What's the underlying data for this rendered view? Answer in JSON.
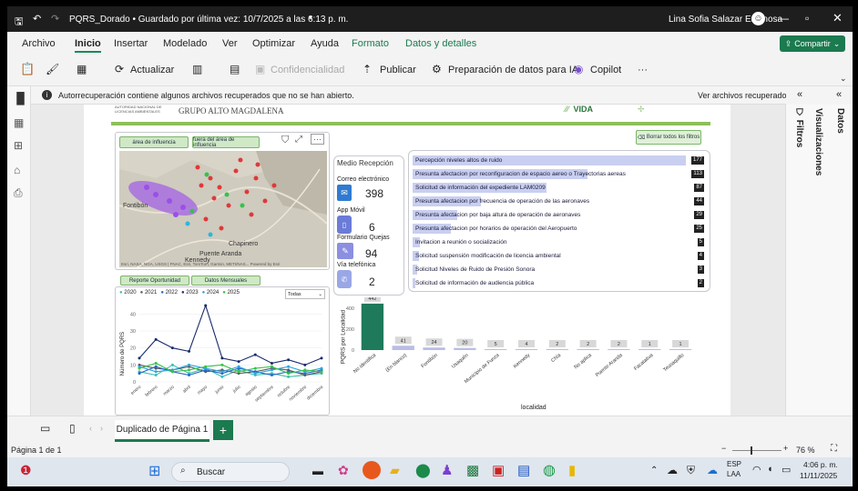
{
  "title_bar": {
    "file_title": "PQRS_Dorado • Guardado por última vez: 10/7/2025 a las 6:13 p. m.",
    "user": "Lina Sofia Salazar Espinosa"
  },
  "ribbon": {
    "tabs": [
      "Archivo",
      "Inicio",
      "Insertar",
      "Modelado",
      "Ver",
      "Optimizar",
      "Ayuda",
      "Formato",
      "Datos y detalles"
    ],
    "share": "Compartir",
    "toolbar": {
      "refresh": "Actualizar",
      "confidentiality": "Confidencialidad",
      "publish": "Publicar",
      "ai_prep": "Preparación de datos para IA",
      "copilot": "Copilot",
      "more": "···"
    }
  },
  "infobar": {
    "message": "Autorrecuperación contiene algunos archivos recuperados que no se han abierto.",
    "action": "Ver archivos recuperados"
  },
  "report": {
    "org_small": "AUTORIDAD NACIONAL DE LICENCIAS AMBIENTALES",
    "header": "GRUPO ALTO MAGDALENA",
    "logo": "VIDA",
    "clear_filters": "Borrar todos los filtros",
    "map_buttons": [
      "área de influencia",
      "fuera del área de influencia"
    ],
    "map_places": [
      "Fontibón",
      "Chapinero",
      "Puente Aranda",
      "Kennedy"
    ],
    "map_attribution": "Esri, NASA, NGA, USGS | FNAC, Esri, TomTom, Garmin, METI/NAS...   Powered by Esri",
    "tabs": [
      "Reporte Oportunidad",
      "Datos Mensuales"
    ],
    "medio": {
      "title": "Medio Recepción",
      "items": [
        {
          "label": "Correo electrónico",
          "value": "398"
        },
        {
          "label": "App Móvil",
          "value": "6"
        },
        {
          "label": "Formulario Quejas",
          "value": "94"
        },
        {
          "label": "Vía telefónica",
          "value": "2"
        }
      ]
    },
    "top_list": [
      {
        "label": "Percepción niveles altos de ruido",
        "value": "177"
      },
      {
        "label": "Presunta afectacion por reconfiguracion de espacio aereo o Trayectorias aereas",
        "value": "113"
      },
      {
        "label": "Solicitud de información del expediente LAM0209",
        "value": "87"
      },
      {
        "label": "Presunta afectacion por frecuencia de operación de las aeronaves",
        "value": "44"
      },
      {
        "label": "Presunta afectacion por baja altura de operación de aeronaves",
        "value": "29"
      },
      {
        "label": "Presunta afectacion por horarios de operación del Aeropuerto",
        "value": "25"
      },
      {
        "label": "Invitacion a reunión o socialización",
        "value": "5"
      },
      {
        "label": "Solicitud suspensión modificación de licencia ambiental",
        "value": "4"
      },
      {
        "label": "Solicitud Niveles de Ruido de Presión Sonora",
        "value": "3"
      },
      {
        "label": "Solicitud de información de audiencia pública",
        "value": "2"
      }
    ],
    "line_chart": {
      "legend": [
        "2020",
        "2021",
        "2022",
        "2023",
        "2024",
        "2025"
      ],
      "filter": "Todas",
      "ylabel": "Número de PQRS",
      "months": [
        "enero",
        "febrero",
        "marzo",
        "abril",
        "mayo",
        "junio",
        "julio",
        "agosto",
        "septiembre",
        "octubre",
        "noviembre",
        "diciembre"
      ]
    },
    "bar_chart": {
      "ylabel": "PQRS por Localidad",
      "xlabel": "localidad"
    }
  },
  "side_panes": [
    "Filtros",
    "Visualizaciones",
    "Datos"
  ],
  "page_tab": "Duplicado de Página 1",
  "status": {
    "page": "Página 1 de 1",
    "zoom": "76 %"
  },
  "taskbar": {
    "search": "Buscar",
    "lang": "ESP",
    "lang2": "LAA",
    "time": "4:06 p. m.",
    "date": "11/11/2025"
  },
  "chart_data": [
    {
      "type": "line",
      "title": "",
      "ylabel": "Número de PQRS",
      "categories": [
        "enero",
        "febrero",
        "marzo",
        "abril",
        "mayo",
        "junio",
        "julio",
        "agosto",
        "septiembre",
        "octubre",
        "noviembre",
        "diciembre"
      ],
      "ylim": [
        0,
        45
      ],
      "series": [
        {
          "name": "2020",
          "color": "#3cbfb0",
          "values": [
            6,
            4,
            10,
            5,
            8,
            3,
            7,
            4,
            5,
            3,
            4,
            5
          ]
        },
        {
          "name": "2021",
          "color": "#5b5b5b",
          "values": [
            10,
            8,
            7,
            9,
            6,
            7,
            5,
            6,
            8,
            7,
            4,
            6
          ]
        },
        {
          "name": "2022",
          "color": "#2a66c8",
          "values": [
            5,
            9,
            6,
            4,
            7,
            5,
            8,
            6,
            4,
            6,
            5,
            7
          ]
        },
        {
          "name": "2023",
          "color": "#1a2a6c",
          "values": [
            14,
            25,
            20,
            18,
            45,
            14,
            12,
            16,
            11,
            13,
            10,
            14
          ]
        },
        {
          "name": "2024",
          "color": "#2fa3e0",
          "values": [
            9,
            6,
            7,
            10,
            8,
            6,
            9,
            5,
            7,
            9,
            6,
            8
          ]
        },
        {
          "name": "2025",
          "color": "#36c24a",
          "values": [
            8,
            11,
            6,
            7,
            9,
            10,
            6,
            8,
            9,
            5,
            7,
            6
          ]
        }
      ]
    },
    {
      "type": "bar",
      "ylabel": "PQRS por Localidad",
      "xlabel": "localidad",
      "ylim": [
        0,
        450
      ],
      "categories": [
        "No identifica",
        "(En blanco)",
        "Fontibón",
        "Usaquén",
        "Municipio de Funza",
        "Kennedy",
        "Chía",
        "No aplica",
        "Puente Aranda",
        "Facatativa",
        "Teusaquillo"
      ],
      "values": [
        442,
        41,
        24,
        20,
        5,
        4,
        2,
        2,
        2,
        1,
        1
      ],
      "colors": [
        "#1e7a5a",
        "#b9bde6",
        "#b9bde6",
        "#b9bde6",
        "#b9bde6",
        "#b9bde6",
        "#b9bde6",
        "#b9bde6",
        "#b9bde6",
        "#b9bde6",
        "#b9bde6"
      ]
    }
  ]
}
